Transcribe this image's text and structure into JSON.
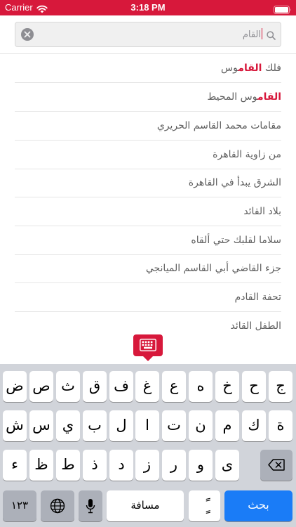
{
  "status_bar": {
    "carrier": "Carrier",
    "time": "3:18 PM"
  },
  "search": {
    "query": "القام"
  },
  "results": [
    {
      "before": "فلك ",
      "highlight": "القام",
      "after": "وس"
    },
    {
      "before": "",
      "highlight": "القام",
      "after": "وس المحيط"
    },
    {
      "before": "",
      "highlight": "",
      "after": "مقامات محمد القاسم الحريري"
    },
    {
      "before": "",
      "highlight": "",
      "after": "من زاوية القاهرة"
    },
    {
      "before": "",
      "highlight": "",
      "after": "الشرق يبدأ في القاهرة"
    },
    {
      "before": "",
      "highlight": "",
      "after": "بلاد القائد"
    },
    {
      "before": "",
      "highlight": "",
      "after": "سلاما لقلبك حتي ألقاه"
    },
    {
      "before": "",
      "highlight": "",
      "after": "جزء القاضي أبي القاسم الميانجي"
    },
    {
      "before": "",
      "highlight": "",
      "after": "تحفة القادم"
    },
    {
      "before": "",
      "highlight": "",
      "after": "الطفل القائد"
    }
  ],
  "keyboard": {
    "row1": [
      "ج",
      "ح",
      "خ",
      "ه",
      "ع",
      "غ",
      "ف",
      "ق",
      "ث",
      "ص",
      "ض"
    ],
    "row2": [
      "ة",
      "ك",
      "م",
      "ن",
      "ت",
      "ا",
      "ل",
      "ب",
      "ي",
      "س",
      "ش"
    ],
    "row3": [
      "ى",
      "و",
      "ر",
      "ز",
      "د",
      "ذ",
      "ط",
      "ظ",
      "ء"
    ],
    "numbers_label": "١٢٣",
    "space_label": "مسافة",
    "tanween_label": "ًٍ",
    "search_label": "بحث"
  }
}
